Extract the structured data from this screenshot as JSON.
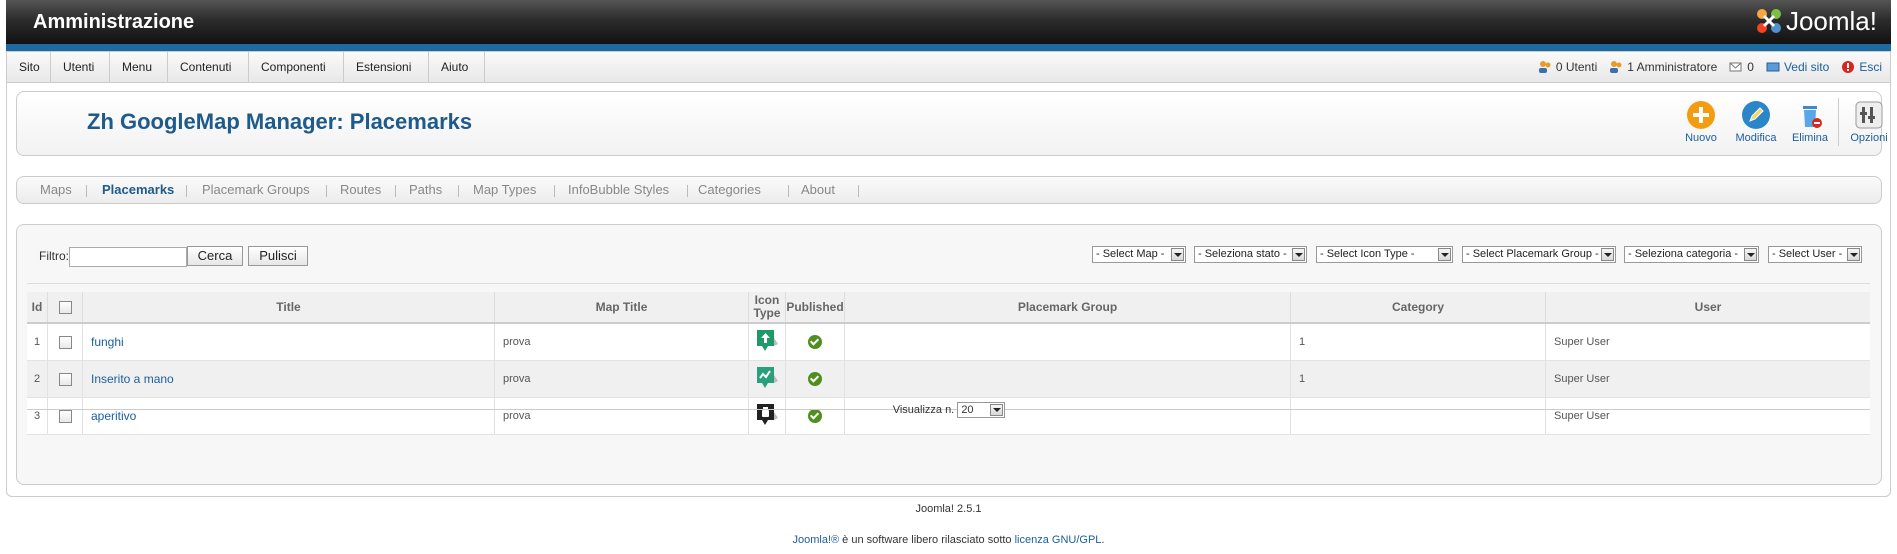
{
  "header": {
    "title": "Amministrazione",
    "logo_text": "Joomla!"
  },
  "menu": {
    "items": [
      "Sito",
      "Utenti",
      "Menu",
      "Contenuti",
      "Componenti",
      "Estensioni",
      "Aiuto"
    ]
  },
  "status": {
    "users": "0 Utenti",
    "admins": "1 Amministratore",
    "messages": "0",
    "view_site": "Vedi sito",
    "logout": "Esci"
  },
  "page": {
    "title": "Zh GoogleMap Manager: Placemarks"
  },
  "toolbar": {
    "new": "Nuovo",
    "edit": "Modifica",
    "delete": "Elimina",
    "options": "Opzioni"
  },
  "tabs": [
    "Maps",
    "Placemarks",
    "Placemark Groups",
    "Routes",
    "Paths",
    "Map Types",
    "InfoBubble Styles",
    "Categories",
    "About"
  ],
  "active_tab": "Placemarks",
  "filter": {
    "label": "Filtro:",
    "value": "",
    "search_button": "Cerca",
    "clear_button": "Pulisci",
    "selects": [
      "- Select Map -",
      "- Seleziona stato -",
      "- Select Icon Type -",
      "- Select Placemark Group -",
      "- Seleziona categoria -",
      "- Select User -"
    ]
  },
  "table": {
    "headers": {
      "id": "Id",
      "title": "Title",
      "map_title": "Map Title",
      "icon_type": "Icon Type",
      "published": "Published",
      "placemark_group": "Placemark Group",
      "category": "Category",
      "user": "User"
    },
    "rows": [
      {
        "id": "1",
        "title": "funghi",
        "map_title": "prova",
        "icon": "up-arrow-marker-icon",
        "icon_color": "#1e9a6a",
        "published": true,
        "placemark_group": "",
        "category": "1",
        "user": "Super User"
      },
      {
        "id": "2",
        "title": "Inserito a mano",
        "map_title": "prova",
        "icon": "draw-marker-icon",
        "icon_color": "#2aa07a",
        "published": true,
        "placemark_group": "",
        "category": "1",
        "user": "Super User"
      },
      {
        "id": "3",
        "title": "aperitivo",
        "map_title": "prova",
        "icon": "bottle-marker-icon",
        "icon_color": "#222222",
        "published": true,
        "placemark_group": "",
        "category": "",
        "user": "Super User"
      }
    ]
  },
  "pagination": {
    "label": "Visualizza n.",
    "value": "20"
  },
  "footer": {
    "version": "Joomla! 2.5.1",
    "license_prefix": "Joomla!®",
    "license_middle": " è un software libero rilasciato sotto ",
    "license_link": "licenza GNU/GPL",
    "license_suffix": "."
  },
  "colors": {
    "brand_blue": "#1c6aa0",
    "title_blue": "#1e5a8a",
    "published_green": "#4e8f1f"
  }
}
